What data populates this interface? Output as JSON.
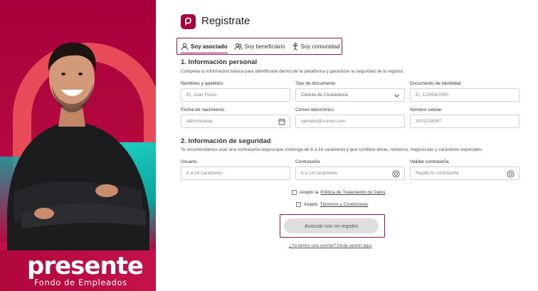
{
  "brand": {
    "name": "presente",
    "tagline": "Fondo de Empleados",
    "accent": "#a8003c"
  },
  "header": {
    "title": "Registrate"
  },
  "tabs": [
    {
      "label": "Soy asociado",
      "icon": "user-icon",
      "active": true
    },
    {
      "label": "Soy beneficiario",
      "icon": "users-icon",
      "active": false
    },
    {
      "label": "Soy comunidad",
      "icon": "community-icon",
      "active": false
    }
  ],
  "personal": {
    "title": "1. Información personal",
    "description": "Completa tu información básica para identificarte dentro de la plataforma y garantizar la seguridad de tu registro.",
    "name": {
      "label": "Nombres y apellidos",
      "placeholder": "Ej. Juan Pérez"
    },
    "doc_type": {
      "label": "Tipo de documento",
      "value": "Cédula de Ciudadanía"
    },
    "doc_id": {
      "label": "Documento de identidad",
      "placeholder": "Ej. 1234567890"
    },
    "birth": {
      "label": "Fecha de nacimiento",
      "placeholder": "dd/mm/aaaa"
    },
    "email": {
      "label": "Correo electrónico",
      "placeholder": "ejemplo@correo.com"
    },
    "phone": {
      "label": "Número celular",
      "placeholder": "3001234567"
    }
  },
  "security": {
    "title": "2. Información de seguridad",
    "description": "Te recomendamos usar una contraseña segura que contenga de 6 a 14 caracteres y que combine letras, números, mayúsculas y caracteres especiales.",
    "user": {
      "label": "Usuario",
      "placeholder": "6 a 14 caracteres"
    },
    "password": {
      "label": "Contraseña",
      "placeholder": "6 a 14 caracteres"
    },
    "confirm": {
      "label": "Validar contraseña",
      "placeholder": "Repite tu contraseña"
    }
  },
  "consents": {
    "privacy_prefix": "Acepto la",
    "privacy_link": "Política de Tratamiento de Datos",
    "terms_prefix": "Acepto",
    "terms_link": "Términos y Condiciones"
  },
  "actions": {
    "submit": "Avanzar con mi registro",
    "login": "¿Ya tienes una cuenta? Inicia sesión aquí"
  }
}
